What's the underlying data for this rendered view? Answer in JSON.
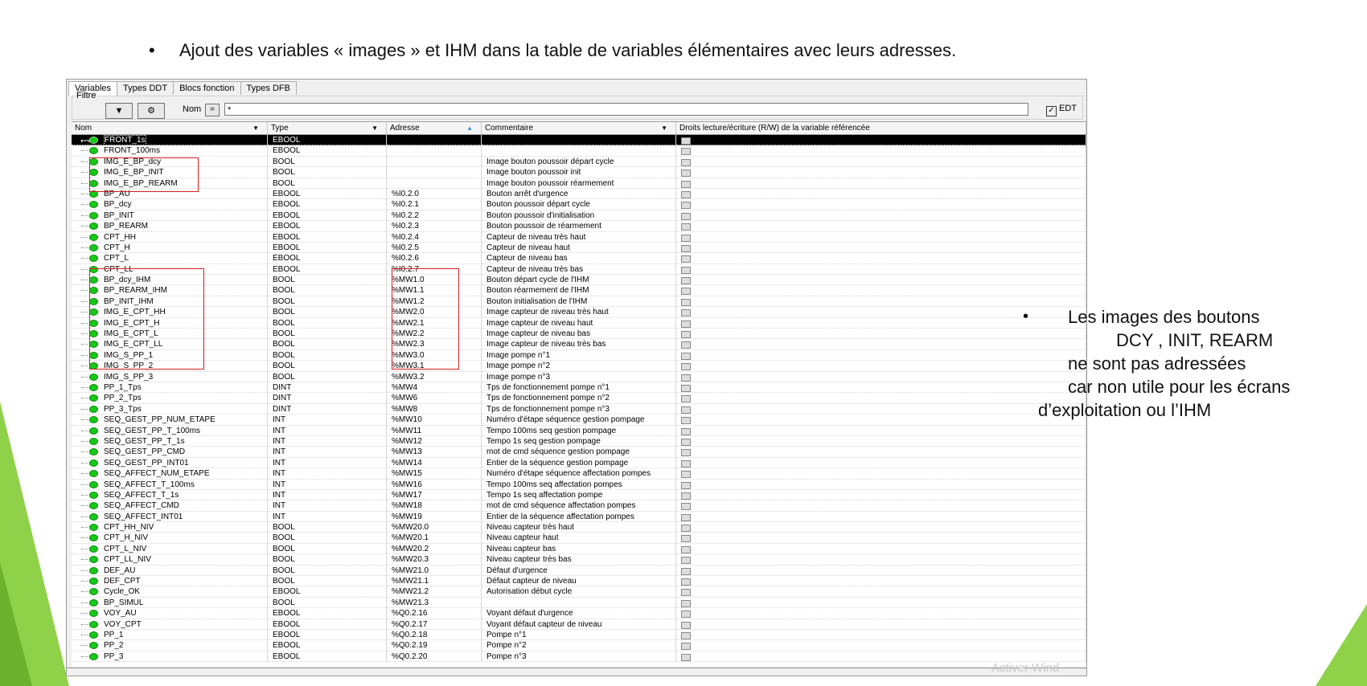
{
  "slide": {
    "bullet": "•",
    "title": "Ajout des variables « images » et IHM dans la table de variables élémentaires avec leurs adresses.",
    "note_lines": [
      "Les images des boutons",
      "DCY , INIT, REARM",
      "ne sont pas adressées",
      "car non utile pour les écrans",
      "d’exploitation ou l’IHM"
    ],
    "watermark": "Activer Wind"
  },
  "colors": {
    "accent_green": "#8fd24a",
    "highlight_red": "#d82020",
    "status_green": "#18c818"
  },
  "editor": {
    "tabs": [
      "Variables",
      "Types DDT",
      "Blocs fonction",
      "Types DFB"
    ],
    "filter_label": "Filtre",
    "nom_label": "Nom",
    "eq_label": "=",
    "filter_value": "*",
    "edt_label": "EDT",
    "edt_check": "✓",
    "columns": {
      "name": "Nom",
      "type": "Type",
      "address": "Adresse",
      "comment": "Commentaire",
      "rw": "Droits lecture/écriture (R/W) de la variable référencée"
    },
    "rows": [
      {
        "name": "FRONT_1s",
        "type": "EBOOL",
        "address": "",
        "comment": ""
      },
      {
        "name": "FRONT_100ms",
        "type": "EBOOL",
        "address": "",
        "comment": ""
      },
      {
        "name": "IMG_E_BP_dcy",
        "type": "BOOL",
        "address": "",
        "comment": "Image bouton poussoir départ cycle"
      },
      {
        "name": "IMG_E_BP_INIT",
        "type": "BOOL",
        "address": "",
        "comment": "Image bouton poussoir init"
      },
      {
        "name": "IMG_E_BP_REARM",
        "type": "BOOL",
        "address": "",
        "comment": "Image bouton poussoir réarmement"
      },
      {
        "name": "BP_AU",
        "type": "EBOOL",
        "address": "%I0.2.0",
        "comment": "Bouton arrêt d'urgence"
      },
      {
        "name": "BP_dcy",
        "type": "EBOOL",
        "address": "%I0.2.1",
        "comment": "Bouton poussoir départ cycle"
      },
      {
        "name": "BP_INIT",
        "type": "EBOOL",
        "address": "%I0.2.2",
        "comment": "Bouton poussoir d'initialisation"
      },
      {
        "name": "BP_REARM",
        "type": "EBOOL",
        "address": "%I0.2.3",
        "comment": "Bouton poussoir de réarmement"
      },
      {
        "name": "CPT_HH",
        "type": "EBOOL",
        "address": "%I0.2.4",
        "comment": "Capteur de niveau très haut"
      },
      {
        "name": "CPT_H",
        "type": "EBOOL",
        "address": "%I0.2.5",
        "comment": "Capteur de niveau haut"
      },
      {
        "name": "CPT_L",
        "type": "EBOOL",
        "address": "%I0.2.6",
        "comment": "Capteur de niveau bas"
      },
      {
        "name": "CPT_LL",
        "type": "EBOOL",
        "address": "%I0.2.7",
        "comment": "Capteur de niveau très bas"
      },
      {
        "name": "BP_dcy_IHM",
        "type": "BOOL",
        "address": "%MW1.0",
        "comment": "Bouton départ cycle de l'IHM"
      },
      {
        "name": "BP_REARM_IHM",
        "type": "BOOL",
        "address": "%MW1.1",
        "comment": "Bouton réarmement de l'IHM"
      },
      {
        "name": "BP_INIT_IHM",
        "type": "BOOL",
        "address": "%MW1.2",
        "comment": "Bouton initialisation de l'IHM"
      },
      {
        "name": "IMG_E_CPT_HH",
        "type": "BOOL",
        "address": "%MW2.0",
        "comment": "Image capteur de niveau très haut"
      },
      {
        "name": "IMG_E_CPT_H",
        "type": "BOOL",
        "address": "%MW2.1",
        "comment": "Image capteur de niveau haut"
      },
      {
        "name": "IMG_E_CPT_L",
        "type": "BOOL",
        "address": "%MW2.2",
        "comment": "Image capteur de niveau bas"
      },
      {
        "name": "IMG_E_CPT_LL",
        "type": "BOOL",
        "address": "%MW2.3",
        "comment": "Image capteur de niveau très bas"
      },
      {
        "name": "IMG_S_PP_1",
        "type": "BOOL",
        "address": "%MW3.0",
        "comment": "Image pompe n°1"
      },
      {
        "name": "IMG_S_PP_2",
        "type": "BOOL",
        "address": "%MW3.1",
        "comment": "Image pompe n°2"
      },
      {
        "name": "IMG_S_PP_3",
        "type": "BOOL",
        "address": "%MW3.2",
        "comment": "Image pompe n°3"
      },
      {
        "name": "PP_1_Tps",
        "type": "DINT",
        "address": "%MW4",
        "comment": "Tps de fonctionnement pompe n°1"
      },
      {
        "name": "PP_2_Tps",
        "type": "DINT",
        "address": "%MW6",
        "comment": "Tps de fonctionnement pompe n°2"
      },
      {
        "name": "PP_3_Tps",
        "type": "DINT",
        "address": "%MW8",
        "comment": "Tps de fonctionnement pompe n°3"
      },
      {
        "name": "SEQ_GEST_PP_NUM_ETAPE",
        "type": "INT",
        "address": "%MW10",
        "comment": "Numéro d'étape séquence gestion pompage"
      },
      {
        "name": "SEQ_GEST_PP_T_100ms",
        "type": "INT",
        "address": "%MW11",
        "comment": "Tempo 100ms seq gestion pompage"
      },
      {
        "name": "SEQ_GEST_PP_T_1s",
        "type": "INT",
        "address": "%MW12",
        "comment": "Tempo 1s seq gestion pompage"
      },
      {
        "name": "SEQ_GEST_PP_CMD",
        "type": "INT",
        "address": "%MW13",
        "comment": "mot de cmd séquence gestion pompage"
      },
      {
        "name": "SEQ_GEST_PP_INT01",
        "type": "INT",
        "address": "%MW14",
        "comment": "Entier de la séquence gestion pompage"
      },
      {
        "name": "SEQ_AFFECT_NUM_ETAPE",
        "type": "INT",
        "address": "%MW15",
        "comment": "Numéro d'étape séquence affectation pompes"
      },
      {
        "name": "SEQ_AFFECT_T_100ms",
        "type": "INT",
        "address": "%MW16",
        "comment": "Tempo 100ms seq affectation pompes"
      },
      {
        "name": "SEQ_AFFECT_T_1s",
        "type": "INT",
        "address": "%MW17",
        "comment": "Tempo 1s seq affectation pompe"
      },
      {
        "name": "SEQ_AFFECT_CMD",
        "type": "INT",
        "address": "%MW18",
        "comment": "mot de cmd séquence affectation pompes"
      },
      {
        "name": "SEQ_AFFECT_INT01",
        "type": "INT",
        "address": "%MW19",
        "comment": "Entier de la séquence affectation pompes"
      },
      {
        "name": "CPT_HH_NIV",
        "type": "BOOL",
        "address": "%MW20.0",
        "comment": "Niveau capteur très haut"
      },
      {
        "name": "CPT_H_NIV",
        "type": "BOOL",
        "address": "%MW20.1",
        "comment": "Niveau capteur haut"
      },
      {
        "name": "CPT_L_NIV",
        "type": "BOOL",
        "address": "%MW20.2",
        "comment": "Niveau capteur bas"
      },
      {
        "name": "CPT_LL_NIV",
        "type": "BOOL",
        "address": "%MW20.3",
        "comment": "Niveau capteur très bas"
      },
      {
        "name": "DEF_AU",
        "type": "BOOL",
        "address": "%MW21.0",
        "comment": "Défaut d'urgence"
      },
      {
        "name": "DEF_CPT",
        "type": "BOOL",
        "address": "%MW21.1",
        "comment": "Défaut capteur de niveau"
      },
      {
        "name": "Cycle_OK",
        "type": "EBOOL",
        "address": "%MW21.2",
        "comment": "Autorisation début cycle"
      },
      {
        "name": "BP_SIMUL",
        "type": "BOOL",
        "address": "%MW21.3",
        "comment": ""
      },
      {
        "name": "VOY_AU",
        "type": "EBOOL",
        "address": "%Q0.2.16",
        "comment": "Voyant défaut d'urgence"
      },
      {
        "name": "VOY_CPT",
        "type": "EBOOL",
        "address": "%Q0.2.17",
        "comment": "Voyant défaut capteur de niveau"
      },
      {
        "name": "PP_1",
        "type": "EBOOL",
        "address": "%Q0.2.18",
        "comment": "Pompe n°1"
      },
      {
        "name": "PP_2",
        "type": "EBOOL",
        "address": "%Q0.2.19",
        "comment": "Pompe n°2"
      },
      {
        "name": "PP_3",
        "type": "EBOOL",
        "address": "%Q0.2.20",
        "comment": "Pompe n°3"
      }
    ]
  }
}
